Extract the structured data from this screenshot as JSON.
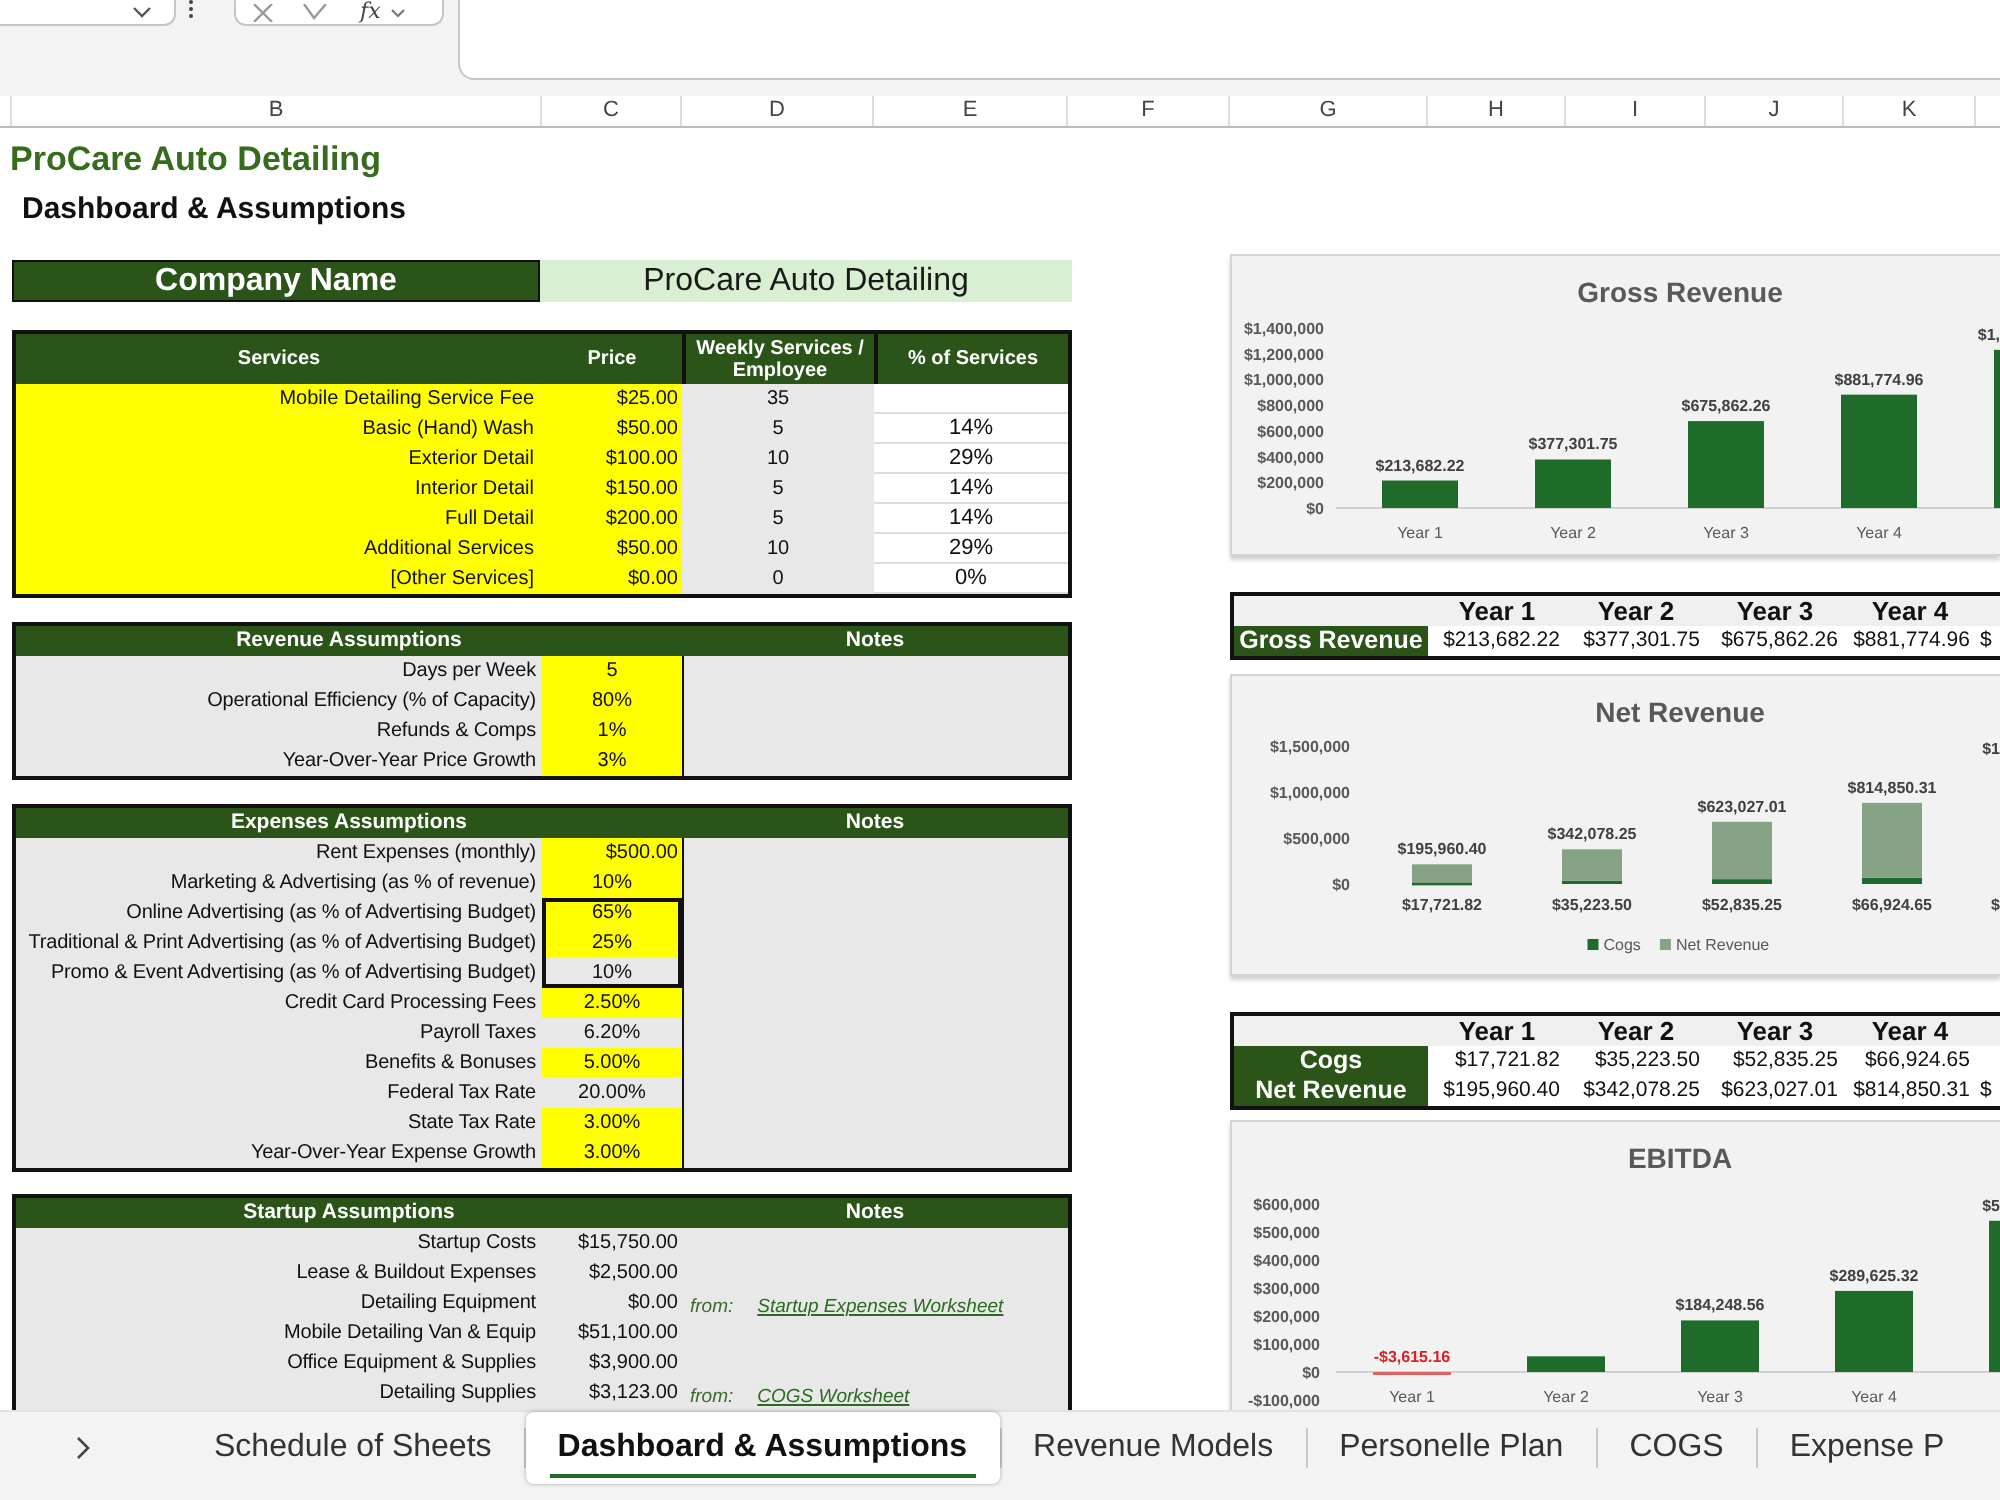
{
  "formula_bar": {
    "function_label": "fx"
  },
  "column_headers": [
    "B",
    "C",
    "D",
    "E",
    "F",
    "G",
    "H",
    "I",
    "J",
    "K"
  ],
  "title": "ProCare Auto Detailing",
  "subtitle": "Dashboard & Assumptions",
  "company": {
    "label": "Company Name",
    "value": "ProCare Auto Detailing"
  },
  "services": {
    "columns": [
      "Services",
      "Price",
      "Weekly Services / Employee",
      "% of Services"
    ],
    "rows": [
      {
        "name": "Mobile Detailing Service Fee",
        "price": "$25.00",
        "weekly": "35"
      },
      {
        "name": "Basic (Hand) Wash",
        "price": "$50.00",
        "weekly": "5",
        "share": "14%"
      },
      {
        "name": "Exterior Detail",
        "price": "$100.00",
        "weekly": "10",
        "share": "29%"
      },
      {
        "name": "Interior Detail",
        "price": "$150.00",
        "weekly": "5",
        "share": "14%"
      },
      {
        "name": "Full Detail",
        "price": "$200.00",
        "weekly": "5",
        "share": "14%"
      },
      {
        "name": "Additional Services",
        "price": "$50.00",
        "weekly": "10",
        "share": "29%"
      },
      {
        "name": "[Other Services]",
        "price": "$0.00",
        "weekly": "0",
        "share": "0%"
      }
    ]
  },
  "revenue_assumptions": {
    "title": "Revenue Assumptions",
    "notes_heading": "Notes",
    "rows": [
      {
        "label": "Days per Week",
        "value": "5",
        "highlighted": true
      },
      {
        "label": "Operational Efficiency (% of Capacity)",
        "value": "80%",
        "highlighted": true
      },
      {
        "label": "Refunds & Comps",
        "value": "1%",
        "highlighted": true
      },
      {
        "label": "Year-Over-Year Price Growth",
        "value": "3%",
        "highlighted": true
      }
    ]
  },
  "expense_assumptions": {
    "title": "Expenses Assumptions",
    "notes_heading": "Notes",
    "rows": [
      {
        "label": "Rent Expenses (monthly)",
        "value": "$500.00",
        "kind": "currency",
        "highlighted": true,
        "grouped": false
      },
      {
        "label": "Marketing & Advertising (as % of revenue)",
        "value": "10%",
        "kind": "percent",
        "highlighted": true,
        "grouped": false
      },
      {
        "label": "Online Advertising (as % of Advertising Budget)",
        "value": "65%",
        "kind": "percent",
        "highlighted": true,
        "grouped": true
      },
      {
        "label": "Traditional & Print Advertising (as % of Advertising Budget)",
        "value": "25%",
        "kind": "percent",
        "highlighted": true,
        "grouped": true
      },
      {
        "label": "Promo & Event Advertising (as % of Advertising Budget)",
        "value": "10%",
        "kind": "percent",
        "highlighted": false,
        "grouped": true
      },
      {
        "label": "Credit Card Processing Fees",
        "value": "2.50%",
        "kind": "percent",
        "highlighted": true,
        "grouped": false
      },
      {
        "label": "Payroll Taxes",
        "value": "6.20%",
        "kind": "percent",
        "highlighted": false,
        "grouped": false
      },
      {
        "label": "Benefits & Bonuses",
        "value": "5.00%",
        "kind": "percent",
        "highlighted": true,
        "grouped": false
      },
      {
        "label": "Federal Tax Rate",
        "value": "20.00%",
        "kind": "percent",
        "highlighted": false,
        "grouped": false
      },
      {
        "label": "State Tax Rate",
        "value": "3.00%",
        "kind": "percent",
        "highlighted": true,
        "grouped": false
      },
      {
        "label": "Year-Over-Year Expense Growth",
        "value": "3.00%",
        "kind": "percent",
        "highlighted": true,
        "grouped": false
      }
    ]
  },
  "startup_assumptions": {
    "title": "Startup Assumptions",
    "notes_heading": "Notes",
    "rows": [
      {
        "label": "Startup Costs",
        "value": "$15,750.00"
      },
      {
        "label": "Lease & Buildout Expenses",
        "value": "$2,500.00"
      },
      {
        "label": "Detailing Equipment",
        "value": "$0.00",
        "note": {
          "prefix": "from:",
          "link": "Startup Expenses Worksheet"
        }
      },
      {
        "label": "Mobile Detailing Van & Equip",
        "value": "$51,100.00"
      },
      {
        "label": "Office Equipment & Supplies",
        "value": "$3,900.00"
      },
      {
        "label": "Detailing Supplies",
        "value": "$3,123.00",
        "note": {
          "prefix": "from:",
          "link": "COGS Worksheet"
        }
      }
    ]
  },
  "gross_revenue_chart": {
    "chart_data": [
      {
        "type": "bar",
        "title": "Gross Revenue",
        "categories": [
          "Year 1",
          "Year 2",
          "Year 3",
          "Year 4",
          null
        ],
        "values": [
          213682.22,
          377301.75,
          675862.26,
          881774.96,
          1230000
        ],
        "color": "#1e6b2a",
        "value_labels": [
          "$213,682.22",
          "$377,301.75",
          "$675,862.26",
          "$881,774.96",
          null
        ],
        "annotations": [
          "$1,"
        ],
        "ylim": [
          0,
          1400000
        ],
        "yticks": [
          {
            "value": 0,
            "label": "$0"
          },
          {
            "value": 200000,
            "label": "$200,000"
          },
          {
            "value": 400000,
            "label": "$400,000"
          },
          {
            "value": 600000,
            "label": "$600,000"
          },
          {
            "value": 800000,
            "label": "$800,000"
          },
          {
            "value": 1000000,
            "label": "$1,000,000"
          },
          {
            "value": 1200000,
            "label": "$1,200,000"
          },
          {
            "value": 1400000,
            "label": "$1,400,000"
          }
        ]
      }
    ]
  },
  "gross_revenue_table": {
    "columns": [
      "Year 1",
      "Year 2",
      "Year 3",
      "Year 4"
    ],
    "rows": [
      {
        "label": "Gross Revenue",
        "values": [
          "$213,682.22",
          "$377,301.75",
          "$675,862.26",
          "$881,774.96",
          "$"
        ]
      }
    ]
  },
  "net_revenue_chart": {
    "chart_data": [
      {
        "type": "bar",
        "stacked": true,
        "title": "Net Revenue",
        "categories": [
          null,
          null,
          null,
          null,
          null
        ],
        "series": [
          {
            "name": "Cogs",
            "color": "#1f6b2f",
            "values": [
              17721.82,
              35223.5,
              52835.25,
              66924.65,
              null
            ],
            "value_labels": [
              "$17,721.82",
              "$35,223.50",
              "$52,835.25",
              "$66,924.65",
              "$"
            ]
          },
          {
            "name": "Net Revenue",
            "color": "#86a386",
            "values": [
              195960.4,
              342078.25,
              623027.01,
              814850.31,
              null
            ],
            "value_labels": [
              "$195,960.40",
              "$342,078.25",
              "$623,027.01",
              "$814,850.31",
              "$1"
            ]
          }
        ],
        "ylim": [
          0,
          1500000
        ],
        "yticks": [
          {
            "value": 0,
            "label": "$0"
          },
          {
            "value": 500000,
            "label": "$500,000"
          },
          {
            "value": 1000000,
            "label": "$1,000,000"
          },
          {
            "value": 1500000,
            "label": "$1,500,000"
          }
        ],
        "legend": "bottom"
      }
    ]
  },
  "cogs_table": {
    "columns": [
      "Year 1",
      "Year 2",
      "Year 3",
      "Year 4"
    ],
    "rows": [
      {
        "label": "Cogs",
        "values": [
          "$17,721.82",
          "$35,223.50",
          "$52,835.25",
          "$66,924.65"
        ]
      },
      {
        "label": "Net Revenue",
        "values": [
          "$195,960.40",
          "$342,078.25",
          "$623,027.01",
          "$814,850.31",
          "$"
        ]
      }
    ]
  },
  "ebitda_chart": {
    "chart_data": [
      {
        "type": "bar",
        "title": "EBITDA",
        "categories": [
          "Year 1",
          "Year 2",
          "Year 3",
          "Year 4",
          null
        ],
        "values": [
          -3615.16,
          56000,
          184248.56,
          289625.32,
          540000
        ],
        "colors": [
          "#e06060",
          "#1e6b2a",
          "#1e6b2a",
          "#1e6b2a",
          "#1e6b2a"
        ],
        "value_labels": [
          "-$3,615.16",
          null,
          "$184,248.56",
          "$289,625.32",
          null
        ],
        "annotations": [
          "$5"
        ],
        "ylim": [
          -100000,
          600000
        ],
        "yticks": [
          {
            "value": -100000,
            "label": "-$100,000"
          },
          {
            "value": 0,
            "label": "$0"
          },
          {
            "value": 100000,
            "label": "$100,000"
          },
          {
            "value": 200000,
            "label": "$200,000"
          },
          {
            "value": 300000,
            "label": "$300,000"
          },
          {
            "value": 400000,
            "label": "$400,000"
          },
          {
            "value": 500000,
            "label": "$500,000"
          },
          {
            "value": 600000,
            "label": "$600,000"
          }
        ]
      }
    ]
  },
  "sheet_tabs": [
    {
      "label": "Schedule of Sheets",
      "selected": false
    },
    {
      "label": "Dashboard & Assumptions",
      "selected": true
    },
    {
      "label": "Revenue Models",
      "selected": false
    },
    {
      "label": "Personelle Plan",
      "selected": false
    },
    {
      "label": "COGS",
      "selected": false
    },
    {
      "label": "Expense P",
      "selected": false
    }
  ]
}
